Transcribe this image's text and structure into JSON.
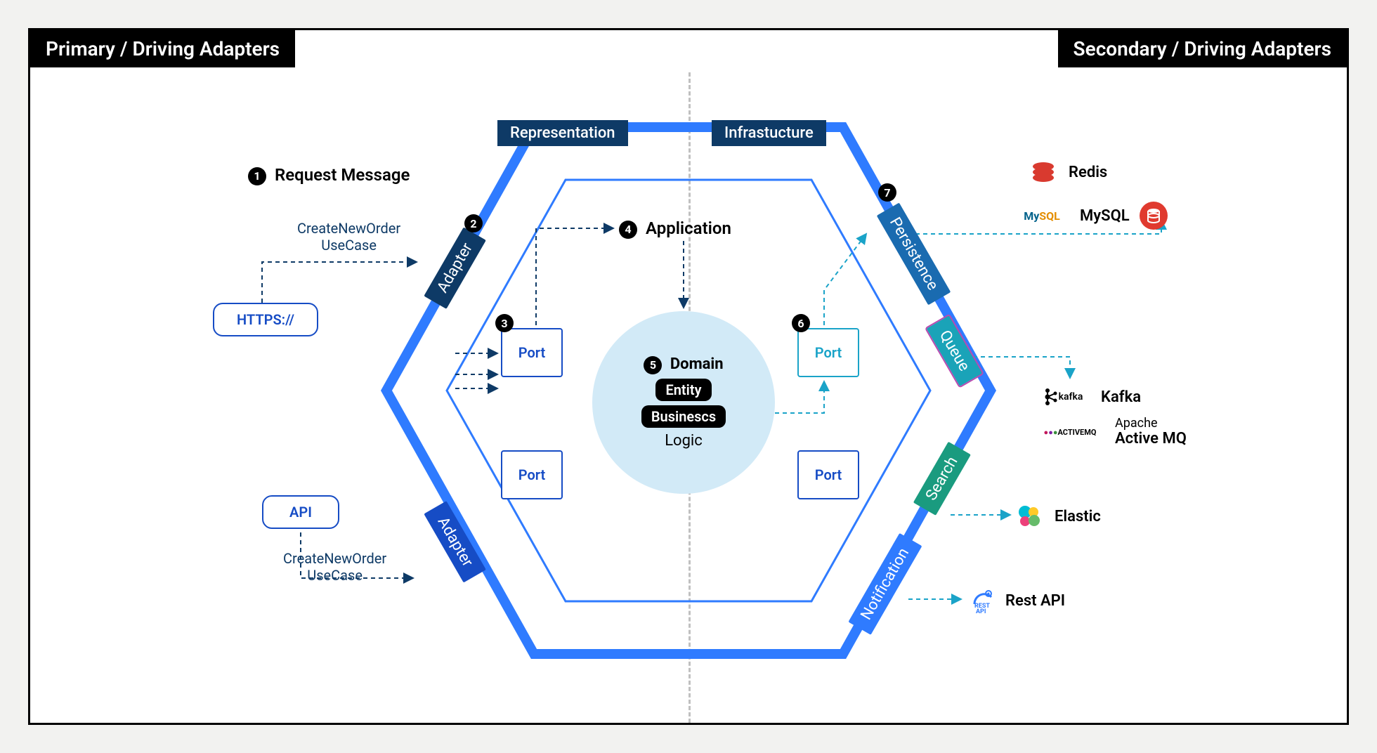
{
  "headers": {
    "left": "Primary / Driving Adapters",
    "right": "Secondary / Driving Adapters"
  },
  "top_labels": {
    "representation": "Representation",
    "infrastructure": "Infrastucture"
  },
  "steps": {
    "s1": "Request Message",
    "s4": "Application",
    "s5": "Domain"
  },
  "domain": {
    "entity": "Entity",
    "business": "Businescs",
    "logic": "Logic"
  },
  "ports": {
    "port": "Port"
  },
  "adapters": {
    "adapter": "Adapter",
    "persistence": "Persistence",
    "queue": "Queue",
    "search": "Search",
    "notification": "Notification"
  },
  "left_boxes": {
    "https": "HTTPS://",
    "api": "API",
    "usecase_l1": "CreateNewOrder",
    "usecase_l2": "UseCase"
  },
  "external": {
    "redis": "Redis",
    "mysql": "MySQL",
    "mysql_brand": "MySQL",
    "kafka": "Kafka",
    "kafka_brand": "kafka",
    "activemq": "Apache\nActive MQ",
    "activemq_brand": "ACTIVEMQ",
    "elastic": "Elastic",
    "restapi": "Rest API"
  }
}
